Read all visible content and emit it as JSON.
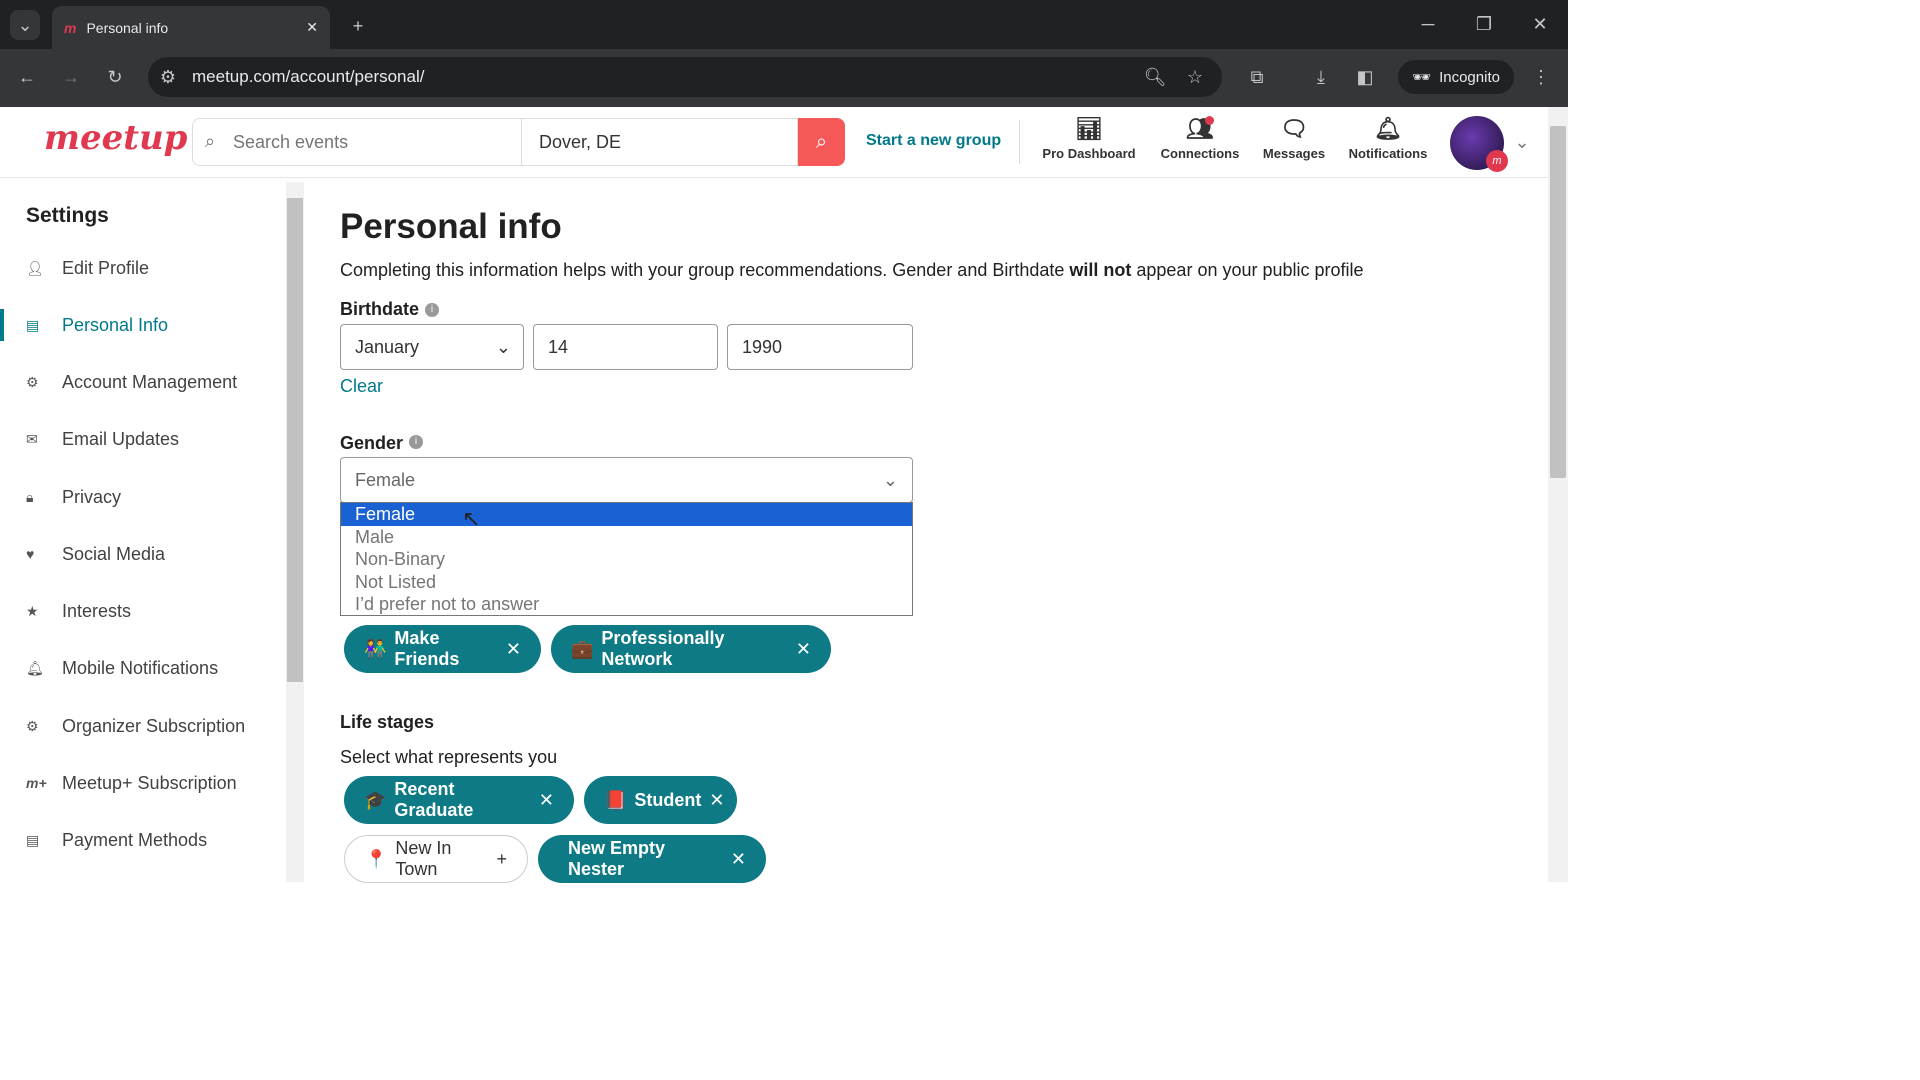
{
  "browser": {
    "tab_title": "Personal info",
    "url": "meetup.com/account/personal/",
    "incognito_label": "Incognito"
  },
  "header": {
    "logo": "meetup",
    "search_placeholder": "Search events",
    "location": "Dover, DE",
    "start_group": "Start a new group",
    "nav": [
      {
        "label": "Pro Dashboard",
        "icon": "chart-icon"
      },
      {
        "label": "Connections",
        "icon": "people-icon"
      },
      {
        "label": "Messages",
        "icon": "chat-icon"
      },
      {
        "label": "Notifications",
        "icon": "bell-icon"
      }
    ]
  },
  "sidebar": {
    "title": "Settings",
    "items": [
      {
        "label": "Edit Profile",
        "icon": "person-icon"
      },
      {
        "label": "Personal Info",
        "icon": "document-icon",
        "active": true
      },
      {
        "label": "Account Management",
        "icon": "gear-icon"
      },
      {
        "label": "Email Updates",
        "icon": "mail-icon"
      },
      {
        "label": "Privacy",
        "icon": "lock-icon"
      },
      {
        "label": "Social Media",
        "icon": "heart-chat-icon"
      },
      {
        "label": "Interests",
        "icon": "star-icon"
      },
      {
        "label": "Mobile Notifications",
        "icon": "bell-icon"
      },
      {
        "label": "Organizer Subscription",
        "icon": "gear-icon"
      },
      {
        "label": "Meetup+ Subscription",
        "icon": "meetup-plus-icon"
      },
      {
        "label": "Payment Methods",
        "icon": "card-icon"
      }
    ]
  },
  "main": {
    "title": "Personal info",
    "intro_before": "Completing this information helps with your group recommendations. Gender and Birthdate ",
    "intro_bold": "will not",
    "intro_after": " appear on your public profile",
    "birthdate_label": "Birthdate",
    "month": "January",
    "day": "14",
    "year": "1990",
    "clear": "Clear",
    "gender_label": "Gender",
    "gender_value": "Female",
    "gender_options": [
      "Female",
      "Male",
      "Non-Binary",
      "Not Listed",
      "I’d prefer not to answer"
    ],
    "reasons": [
      {
        "label": "Make Friends",
        "emoji": "👫"
      },
      {
        "label": "Professionally Network",
        "emoji": "💼"
      }
    ],
    "life_stages_title": "Life stages",
    "life_stages_sub": "Select what represents you",
    "life_stages": [
      {
        "label": "Recent Graduate",
        "emoji": "🎓",
        "selected": true
      },
      {
        "label": "Student",
        "emoji": "📕",
        "selected": true
      },
      {
        "label": "New In Town",
        "emoji": "📍",
        "selected": false
      },
      {
        "label": "New Empty Nester",
        "emoji": "",
        "selected": true
      }
    ]
  },
  "colors": {
    "accent": "#00798a",
    "chip": "#0d7a86",
    "brand": "#e0394f",
    "search_button": "#f65858",
    "selected_option": "#1a62d4"
  }
}
